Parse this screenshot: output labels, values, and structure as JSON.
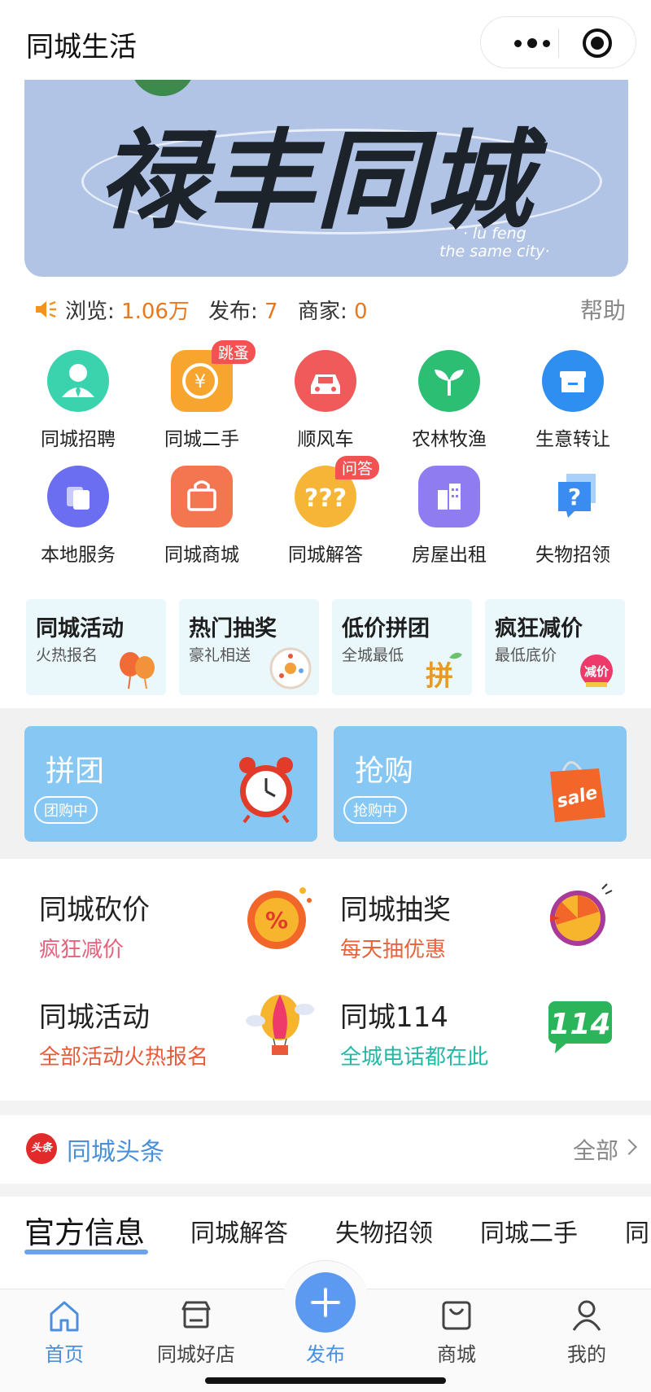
{
  "header": {
    "title": "同城生活"
  },
  "banner": {
    "title": "禄丰同城",
    "en_line1": "· lu feng",
    "en_line2": "the same city·"
  },
  "stats": {
    "views_label": "浏览:",
    "views_value": "1.06万",
    "posts_label": "发布:",
    "posts_value": "7",
    "merchants_label": "商家:",
    "merchants_value": "0",
    "help": "帮助"
  },
  "grid": [
    {
      "label": "同城招聘",
      "icon": "recruit-icon",
      "color": "#3ad3ad"
    },
    {
      "label": "同城二手",
      "icon": "secondhand-icon",
      "color": "#f8a52f",
      "badge": "跳蚤"
    },
    {
      "label": "顺风车",
      "icon": "car-icon",
      "color": "#f05a5a"
    },
    {
      "label": "农林牧渔",
      "icon": "sprout-icon",
      "color": "#2cbf74"
    },
    {
      "label": "生意转让",
      "icon": "shop-icon",
      "color": "#2f8ff0"
    },
    {
      "label": "本地服务",
      "icon": "service-icon",
      "color": "#6b6ef0"
    },
    {
      "label": "同城商城",
      "icon": "bag-icon",
      "color": "#f47650"
    },
    {
      "label": "同城解答",
      "icon": "question-icon",
      "color": "#f6b536",
      "badge": "问答"
    },
    {
      "label": "房屋出租",
      "icon": "building-icon",
      "color": "#8f7cf0"
    },
    {
      "label": "失物招领",
      "icon": "lost-found-icon",
      "color": "#3a8cf0"
    }
  ],
  "promos": [
    {
      "title": "同城活动",
      "sub": "火热报名",
      "icon": "balloon-icon"
    },
    {
      "title": "热门抽奖",
      "sub": "豪礼相送",
      "icon": "wheel-icon"
    },
    {
      "title": "低价拼团",
      "sub": "全城最低",
      "icon": "pin-icon"
    },
    {
      "title": "疯狂减价",
      "sub": "最低底价",
      "icon": "discount-icon"
    }
  ],
  "bluecards": [
    {
      "title": "拼团",
      "pill": "团购中",
      "icon": "alarm-clock-icon"
    },
    {
      "title": "抢购",
      "pill": "抢购中",
      "icon": "sale-bag-icon"
    }
  ],
  "functions": [
    {
      "title": "同城砍价",
      "sub": "疯狂减价",
      "sub_color": "#e8607a",
      "icon": "percent-icon"
    },
    {
      "title": "同城抽奖",
      "sub": "每天抽优惠",
      "sub_color": "#e8623a",
      "icon": "lottery-wheel-icon"
    },
    {
      "title": "同城活动",
      "sub": "全部活动火热报名",
      "sub_color": "#e85a3a",
      "icon": "hot-air-balloon-icon"
    },
    {
      "title": "同城114",
      "sub": "全城电话都在此",
      "sub_color": "#23b8a6",
      "icon": "phone-114-icon"
    }
  ],
  "headline": {
    "logo": "头条",
    "title": "同城头条",
    "all": "全部"
  },
  "tabs": [
    "官方信息",
    "同城解答",
    "失物招领",
    "同城二手",
    "同"
  ],
  "nav": [
    {
      "label": "首页",
      "icon": "home-icon"
    },
    {
      "label": "同城好店",
      "icon": "store-icon"
    },
    {
      "label": "发布",
      "icon": "plus-icon"
    },
    {
      "label": "商城",
      "icon": "shopping-bag-icon"
    },
    {
      "label": "我的",
      "icon": "user-icon"
    }
  ]
}
